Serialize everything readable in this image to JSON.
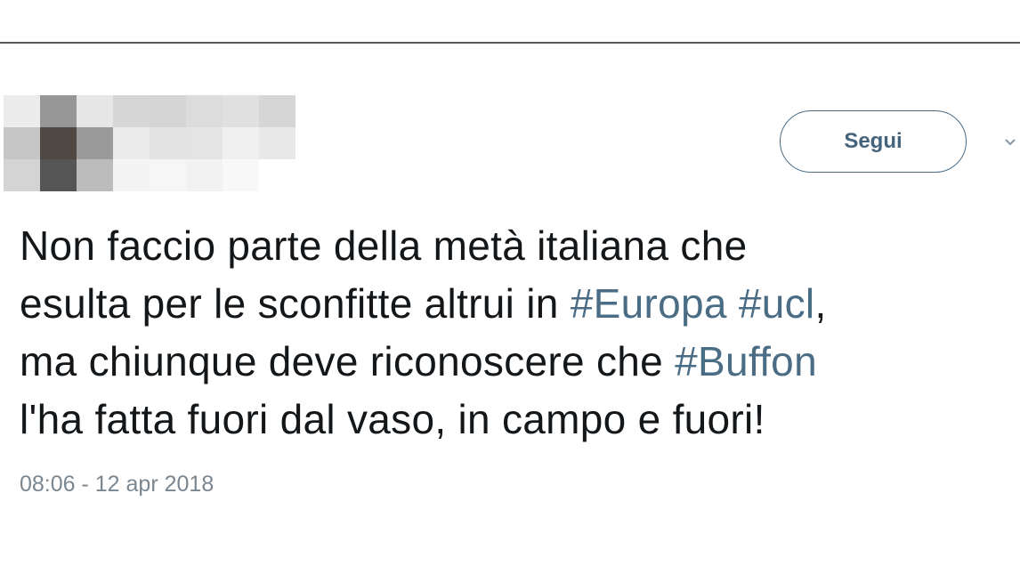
{
  "header": {},
  "author": {
    "avatar_pixel_colors": [
      "#ececec",
      "#969696",
      "#e6e6e6",
      "#d6d6d6",
      "#d4d4d4",
      "#dcdcdc",
      "#e0e0e0",
      "#d6d6d6",
      "#ffffff",
      "#c6c6c6",
      "#4f4843",
      "#9a9a9a",
      "#ececec",
      "#e3e3e3",
      "#e4e4e4",
      "#f0f0f0",
      "#e8e8e8",
      "#ffffff",
      "#d4d4d4",
      "#555555",
      "#bcbcbc",
      "#f4f4f4",
      "#f6f6f6",
      "#f2f2f2",
      "#f8f8f8",
      "#ffffff",
      "#ffffff"
    ]
  },
  "follow_button": {
    "label": "Segui"
  },
  "tweet": {
    "text_segments": [
      "Non faccio parte della metà italiana che",
      "esulta per le sconfitte altrui in ",
      " ",
      ",",
      "ma chiunque deve riconoscere che ",
      "l'ha fatta fuori dal vaso, in campo e fuori!"
    ],
    "hashtags": [
      "#Europa",
      "#ucl",
      "#Buffon"
    ],
    "timestamp": "08:06 - 12 apr 2018"
  },
  "colors": {
    "link": "#4a6c85",
    "text": "#14171a",
    "muted": "#7a8690",
    "divider": "#555a5e"
  },
  "icons": [
    "chevron-down-icon"
  ]
}
